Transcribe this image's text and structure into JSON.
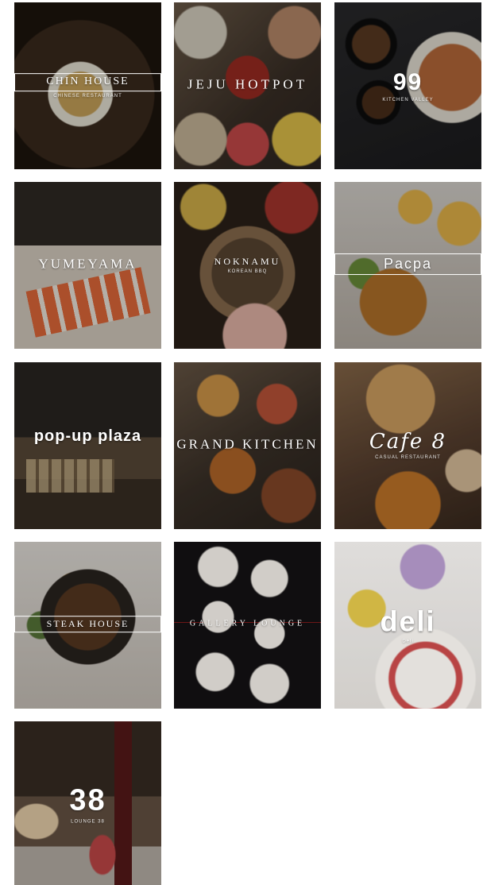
{
  "restaurants": [
    {
      "main": "CHIN HOUSE",
      "sub": "CHINESE RESTAURANT"
    },
    {
      "main": "JEJU HOTPOT",
      "sub": ""
    },
    {
      "main": "99",
      "sub": "KITCHEN VALLEY"
    },
    {
      "main": "YUMEYAMA",
      "sub": ""
    },
    {
      "main": "NOKNAMU",
      "sub": "KOREAN BBQ"
    },
    {
      "main": "Pacpa",
      "sub": ""
    },
    {
      "main": "pop-up plaza",
      "sub": ""
    },
    {
      "main": "GRAND KITCHEN",
      "sub": ""
    },
    {
      "main": "Cafe 8",
      "sub": "CASUAL RESTAURANT"
    },
    {
      "main": "STEAK HOUSE",
      "sub": ""
    },
    {
      "main": "GALLERY LOUNGE",
      "sub": ""
    },
    {
      "main": "deli",
      "sub": "Deli"
    },
    {
      "main": "38",
      "sub": "LOUNGE 38"
    }
  ],
  "icons": {
    "tile_image": "restaurant-photo"
  }
}
